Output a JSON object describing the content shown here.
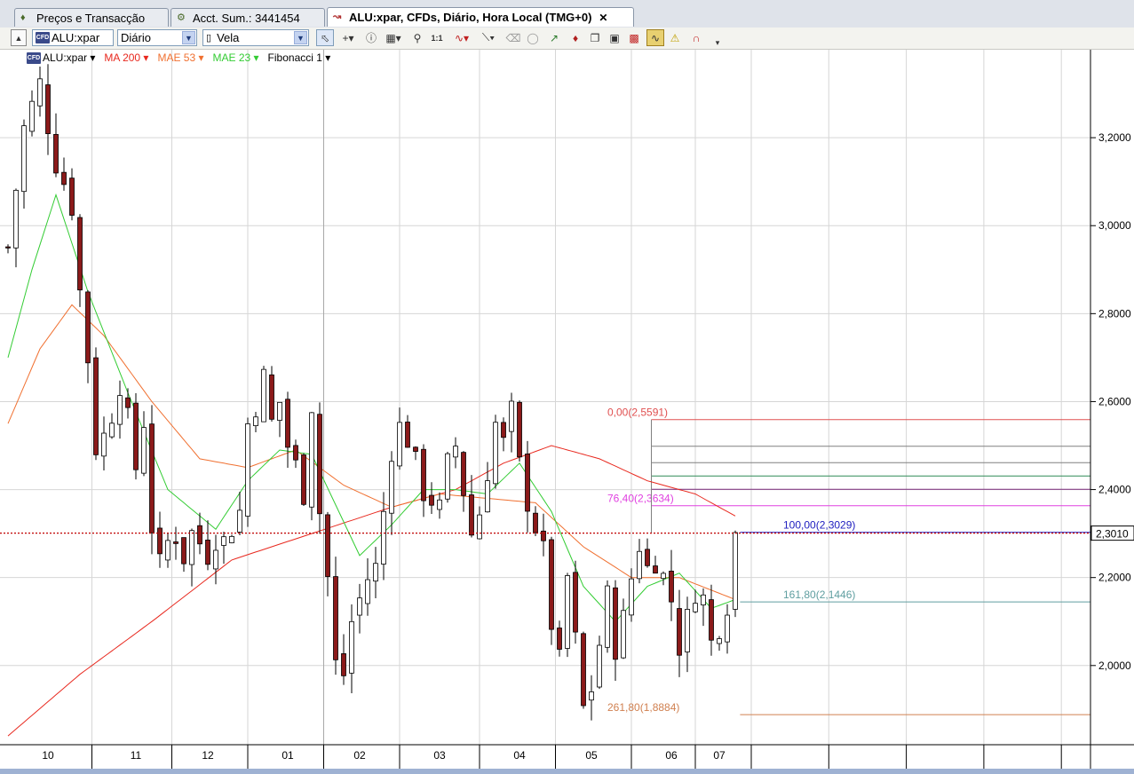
{
  "tabs": [
    {
      "label": "Preços e Transacção",
      "icon": "price-tag-icon",
      "active": false
    },
    {
      "label": "Acct. Sum.: 3441454",
      "icon": "account-icon",
      "active": false
    },
    {
      "label": "ALU:xpar, CFDs, Diário, Hora Local (TMG+0)",
      "icon": "chart-icon",
      "active": true
    }
  ],
  "toolbar": {
    "instrument_value": "ALU:xpar",
    "period_value": "Diário",
    "chart_type_value": "Vela",
    "tools": [
      "select-arrow-icon",
      "crosshair-icon",
      "info-icon",
      "grid-icon",
      "zoom-icon",
      "one-to-one-icon",
      "indicator-icon",
      "line-draw-icon",
      "eraser-icon",
      "hide-icon",
      "fibonacci-icon",
      "trade-icon",
      "copy-icon",
      "compare-icon",
      "alert-icon",
      "magnet-icon",
      "menu-icon"
    ]
  },
  "legend": [
    {
      "label": "ALU:xpar",
      "color": "#000000"
    },
    {
      "label": "MA 200",
      "color": "#e8281e"
    },
    {
      "label": "MAE 53",
      "color": "#f07030"
    },
    {
      "label": "MAE 23",
      "color": "#33cc33"
    },
    {
      "label": "Fibonacci 1",
      "color": "#000000"
    }
  ],
  "chart_data": {
    "type": "candlestick",
    "instrument": "ALU:xpar",
    "interval": "Diário",
    "ylim": [
      1.82,
      3.4
    ],
    "y_ticks": [
      "2,0000",
      "2,2000",
      "2,4000",
      "2,6000",
      "2,8000",
      "3,0000",
      "3,2000"
    ],
    "x_ticks": [
      {
        "label": "10",
        "bar": 5
      },
      {
        "label": "11",
        "bar": 16
      },
      {
        "label": "12",
        "bar": 25
      },
      {
        "label": "01",
        "bar": 35
      },
      {
        "label": "02",
        "bar": 44
      },
      {
        "label": "03",
        "bar": 54
      },
      {
        "label": "04",
        "bar": 64
      },
      {
        "label": "05",
        "bar": 73
      },
      {
        "label": "06",
        "bar": 83
      },
      {
        "label": "07",
        "bar": 89
      }
    ],
    "last_price": 2.301,
    "last_price_label": "2,3010",
    "fibonacci": [
      {
        "level": 0.0,
        "price": 2.5591,
        "label": "0,00(2,5591)",
        "color": "#e05050"
      },
      {
        "level": 0.236,
        "price": 2.4986,
        "label": "",
        "color": "#808080"
      },
      {
        "level": 0.382,
        "price": 2.4612,
        "label": "",
        "color": "#808080"
      },
      {
        "level": 0.5,
        "price": 2.431,
        "label": "",
        "color": "#2e8b57"
      },
      {
        "level": 0.618,
        "price": 2.4007,
        "label": "",
        "color": "#7a2a7a"
      },
      {
        "level": 0.764,
        "price": 2.3634,
        "label": "76,40(2,3634)",
        "color": "#e040e0"
      },
      {
        "level": 1.0,
        "price": 2.3029,
        "label": "100,00(2,3029)",
        "color": "#2020c0"
      },
      {
        "level": 1.618,
        "price": 2.1446,
        "label": "161,80(2,1446)",
        "color": "#5f9ea0"
      },
      {
        "level": 2.618,
        "price": 1.8884,
        "label": "261,80(1,8884)",
        "color": "#d08050"
      }
    ],
    "series": [
      {
        "name": "ALU:xpar",
        "kind": "ohlc",
        "close_anchors": [
          [
            0,
            2.95
          ],
          [
            2,
            3.22
          ],
          [
            4,
            3.32
          ],
          [
            6,
            3.15
          ],
          [
            8,
            3.05
          ],
          [
            9,
            2.85
          ],
          [
            10,
            2.7
          ],
          [
            11,
            2.5
          ],
          [
            12,
            2.52
          ],
          [
            13,
            2.58
          ],
          [
            14,
            2.65
          ],
          [
            15,
            2.55
          ],
          [
            16,
            2.45
          ],
          [
            17,
            2.56
          ],
          [
            18,
            2.32
          ],
          [
            19,
            2.22
          ],
          [
            20,
            2.28
          ],
          [
            21,
            2.3
          ],
          [
            22,
            2.25
          ],
          [
            23,
            2.3
          ],
          [
            24,
            2.28
          ],
          [
            25,
            2.26
          ],
          [
            26,
            2.3
          ],
          [
            27,
            2.28
          ],
          [
            28,
            2.32
          ],
          [
            29,
            2.35
          ],
          [
            30,
            2.55
          ],
          [
            31,
            2.6
          ],
          [
            32,
            2.65
          ],
          [
            33,
            2.55
          ],
          [
            34,
            2.6
          ],
          [
            35,
            2.5
          ],
          [
            36,
            2.45
          ],
          [
            37,
            2.4
          ],
          [
            38,
            2.6
          ],
          [
            39,
            2.35
          ],
          [
            40,
            2.2
          ],
          [
            41,
            2.0
          ],
          [
            42,
            1.98
          ],
          [
            43,
            2.1
          ],
          [
            44,
            2.15
          ],
          [
            45,
            2.2
          ],
          [
            46,
            2.22
          ],
          [
            47,
            2.35
          ],
          [
            48,
            2.5
          ],
          [
            49,
            2.54
          ],
          [
            50,
            2.52
          ],
          [
            51,
            2.45
          ],
          [
            52,
            2.4
          ],
          [
            53,
            2.38
          ],
          [
            54,
            2.35
          ],
          [
            55,
            2.45
          ],
          [
            56,
            2.5
          ],
          [
            57,
            2.4
          ],
          [
            58,
            2.3
          ],
          [
            59,
            2.35
          ],
          [
            60,
            2.45
          ],
          [
            61,
            2.55
          ],
          [
            62,
            2.5
          ],
          [
            63,
            2.57
          ],
          [
            64,
            2.45
          ],
          [
            65,
            2.38
          ],
          [
            66,
            2.32
          ],
          [
            67,
            2.25
          ],
          [
            68,
            2.1
          ],
          [
            69,
            2.0
          ],
          [
            70,
            2.2
          ],
          [
            71,
            2.05
          ],
          [
            72,
            1.9
          ],
          [
            73,
            1.95
          ],
          [
            74,
            2.05
          ],
          [
            75,
            2.15
          ],
          [
            76,
            2.05
          ],
          [
            77,
            2.1
          ],
          [
            78,
            2.2
          ],
          [
            79,
            2.28
          ],
          [
            80,
            2.22
          ],
          [
            81,
            2.25
          ],
          [
            82,
            2.2
          ],
          [
            83,
            2.15
          ],
          [
            84,
            2.05
          ],
          [
            85,
            2.1
          ],
          [
            86,
            2.18
          ],
          [
            87,
            2.15
          ],
          [
            88,
            2.05
          ],
          [
            89,
            2.1
          ],
          [
            90,
            2.15
          ],
          [
            91,
            2.3
          ]
        ]
      },
      {
        "name": "MA 200",
        "kind": "line",
        "color": "#e8281e",
        "anchors": [
          [
            0,
            1.84
          ],
          [
            9,
            1.98
          ],
          [
            18,
            2.1
          ],
          [
            28,
            2.24
          ],
          [
            38,
            2.3
          ],
          [
            48,
            2.36
          ],
          [
            56,
            2.4
          ],
          [
            62,
            2.46
          ],
          [
            68,
            2.5
          ],
          [
            74,
            2.47
          ],
          [
            80,
            2.42
          ],
          [
            86,
            2.39
          ],
          [
            91,
            2.34
          ]
        ]
      },
      {
        "name": "MAE 53",
        "kind": "line",
        "color": "#f07030",
        "anchors": [
          [
            0,
            2.55
          ],
          [
            4,
            2.72
          ],
          [
            8,
            2.82
          ],
          [
            12,
            2.75
          ],
          [
            18,
            2.6
          ],
          [
            24,
            2.47
          ],
          [
            30,
            2.45
          ],
          [
            36,
            2.49
          ],
          [
            42,
            2.41
          ],
          [
            48,
            2.36
          ],
          [
            54,
            2.39
          ],
          [
            60,
            2.38
          ],
          [
            66,
            2.37
          ],
          [
            72,
            2.27
          ],
          [
            78,
            2.2
          ],
          [
            84,
            2.2
          ],
          [
            91,
            2.15
          ]
        ]
      },
      {
        "name": "MAE 23",
        "kind": "line",
        "color": "#33cc33",
        "anchors": [
          [
            0,
            2.7
          ],
          [
            3,
            2.9
          ],
          [
            6,
            3.07
          ],
          [
            10,
            2.85
          ],
          [
            15,
            2.62
          ],
          [
            20,
            2.4
          ],
          [
            26,
            2.31
          ],
          [
            30,
            2.42
          ],
          [
            34,
            2.49
          ],
          [
            38,
            2.48
          ],
          [
            44,
            2.25
          ],
          [
            48,
            2.32
          ],
          [
            52,
            2.4
          ],
          [
            56,
            2.4
          ],
          [
            60,
            2.39
          ],
          [
            64,
            2.46
          ],
          [
            68,
            2.35
          ],
          [
            72,
            2.18
          ],
          [
            76,
            2.1
          ],
          [
            80,
            2.18
          ],
          [
            84,
            2.21
          ],
          [
            88,
            2.13
          ],
          [
            91,
            2.15
          ]
        ]
      }
    ]
  }
}
